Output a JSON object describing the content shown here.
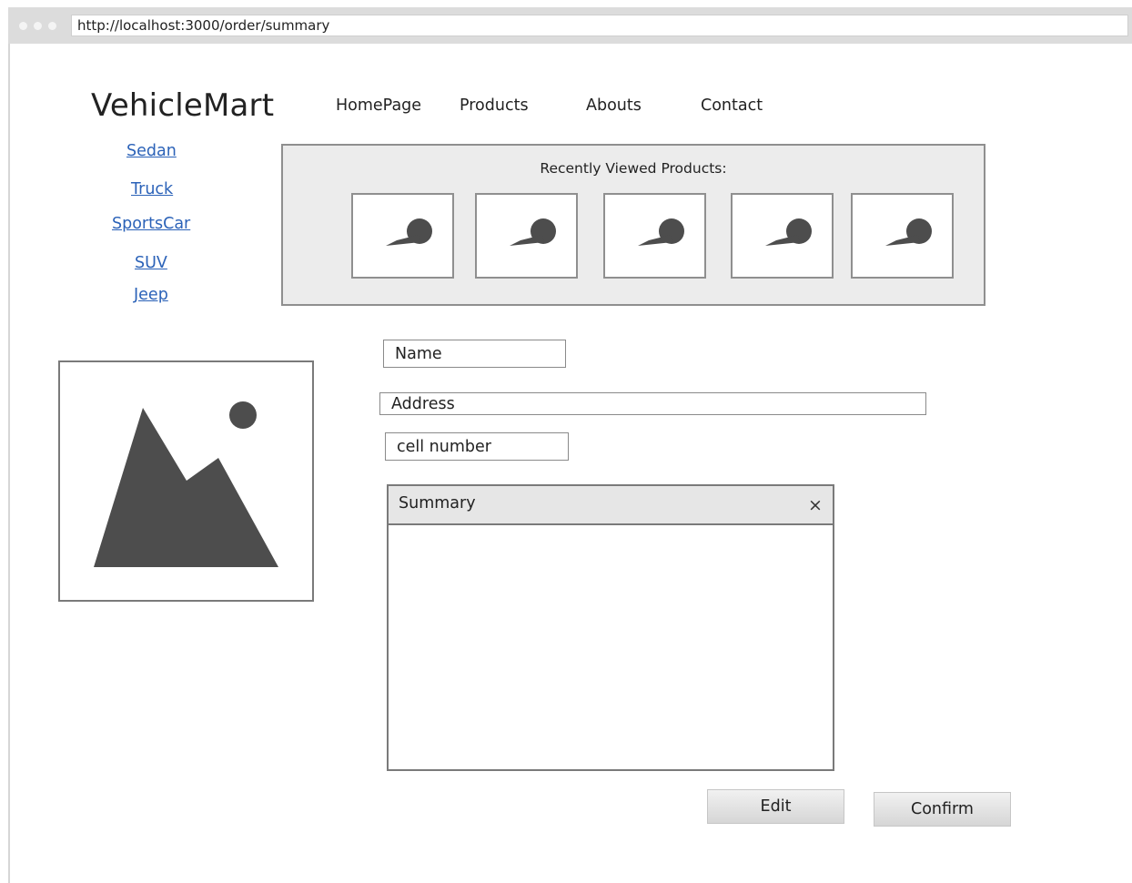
{
  "browser": {
    "url": "http://localhost:3000/order/summary"
  },
  "header": {
    "logo": "VehicleMart",
    "nav": [
      "HomePage",
      "Products",
      "Abouts",
      "Contact"
    ]
  },
  "sidebar": {
    "categories": [
      "Sedan",
      "Truck",
      "SportsCar",
      "SUV",
      "Jeep"
    ]
  },
  "recently_viewed": {
    "title": "Recently Viewed Products:",
    "item_count": 5,
    "icon": "image-placeholder-icon"
  },
  "form": {
    "name_placeholder": "Name",
    "address_placeholder": "Address",
    "cell_placeholder": "cell number"
  },
  "summary": {
    "title": "Summary",
    "close_glyph": "×"
  },
  "buttons": {
    "edit": "Edit",
    "confirm": "Confirm"
  },
  "colors": {
    "link": "#2b62b8",
    "panel_bg": "#ececec",
    "placeholder_shape": "#4d4d4d"
  }
}
